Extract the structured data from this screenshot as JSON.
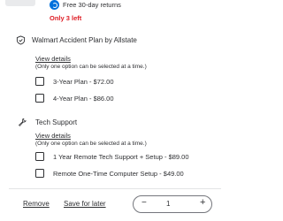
{
  "product": {
    "returns_text": "Free 30-day returns",
    "stock_text": "Only 3 left",
    "returns_icon": "returns-icon",
    "stock_color": "#de1c24",
    "accent_color": "#0071dc"
  },
  "protection_plan": {
    "title": "Walmart Accident Plan by Allstate",
    "icon": "shield-icon",
    "view_details": "View details",
    "note": "(Only one option can be selected at a time.)",
    "options": [
      {
        "label": "3-Year Plan - $72.00",
        "checked": false
      },
      {
        "label": "4-Year Plan - $86.00",
        "checked": false
      }
    ]
  },
  "tech_support": {
    "title": "Tech Support",
    "icon": "wrench-icon",
    "view_details": "View details",
    "note": "(Only one option can be selected at a time.)",
    "options": [
      {
        "label": "1 Year Remote Tech Support + Setup - $89.00",
        "checked": false
      },
      {
        "label": "Remote One-Time Computer Setup - $49.00",
        "checked": false
      }
    ]
  },
  "actions": {
    "remove_label": "Remove",
    "save_label": "Save for later",
    "quantity": "1",
    "minus_symbol": "−",
    "plus_symbol": "+"
  }
}
